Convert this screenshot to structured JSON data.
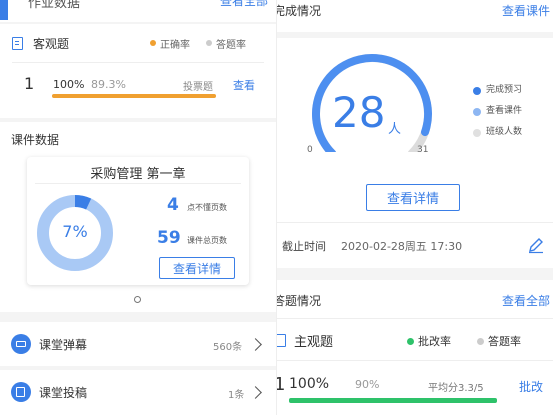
{
  "left": {
    "top_partial_title": "作业数据",
    "top_partial_link": "查看全部",
    "objective": {
      "title": "客观题",
      "legend_correct": "正确率",
      "legend_answer": "答题率",
      "legend_correct_color": "#f0a030",
      "legend_answer_color": "#cccccc",
      "row_index": "1",
      "row_percent": "100%",
      "row_rate": "89.3%",
      "row_type": "投票题",
      "row_link": "查看",
      "bar_fill": 1.0
    },
    "courseware": {
      "section_title": "课件数据",
      "card_title": "采购管理 第一章",
      "donut_label": "7%",
      "donut_fraction": 0.07,
      "stat1_value": "4",
      "stat1_label": "点不懂页数",
      "stat2_value": "59",
      "stat2_label": "课件总页数",
      "detail_button": "查看详情"
    },
    "danmu": {
      "label": "课堂弹幕",
      "count": "560条"
    },
    "tougao": {
      "label": "课堂投稿",
      "count": "1条"
    }
  },
  "right": {
    "completion": {
      "title": "完成情况",
      "link": "查看课件",
      "value": "28",
      "unit": "人",
      "min": "0",
      "max": "31",
      "gauge_fraction": 0.903,
      "legend": [
        {
          "label": "完成预习",
          "color": "#3a7ee6"
        },
        {
          "label": "查看课件",
          "color": "#8db6f2"
        },
        {
          "label": "班级人数",
          "color": "#e0e0e0"
        }
      ],
      "detail_button": "查看详情",
      "deadline_label": "截止时间",
      "deadline_value": "2020-02-28周五 17:30"
    },
    "answers": {
      "title": "答题情况",
      "link": "查看全部",
      "subjective_title": "主观题",
      "legend_grade": "批改率",
      "legend_answer": "答题率",
      "legend_grade_color": "#2ec26a",
      "legend_answer_color": "#cccccc",
      "row_index": "1",
      "row_percent": "100%",
      "row_rate": "90%",
      "row_avg": "平均分3.3/5",
      "row_link": "批改",
      "bar_fill": 1.0
    }
  }
}
